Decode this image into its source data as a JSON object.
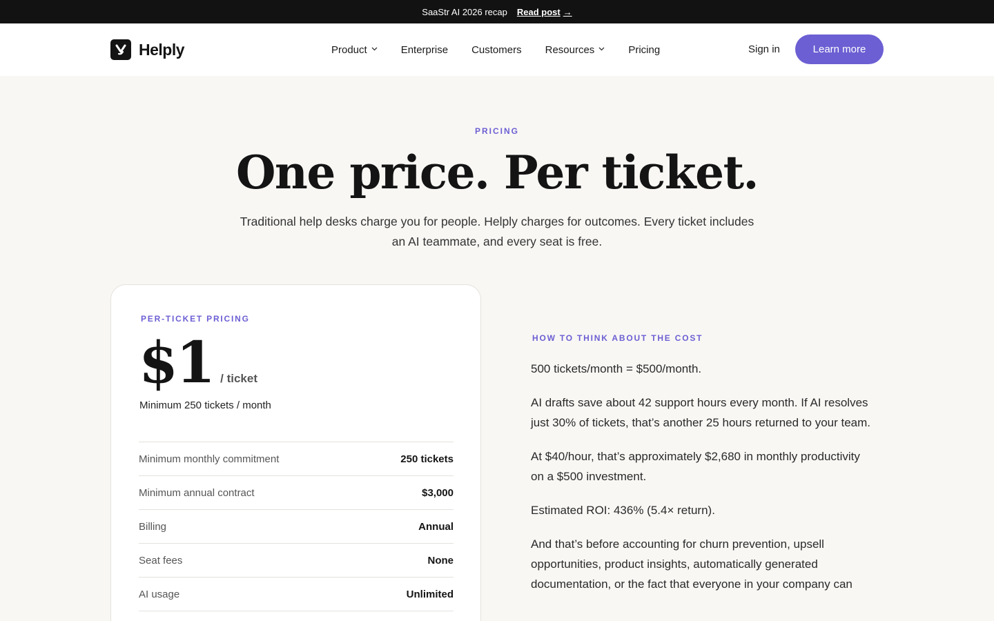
{
  "announcement": {
    "text": "SaaStr AI 2026 recap",
    "link_label": "Read post",
    "link_arrow": "→"
  },
  "header": {
    "brand": "Helply",
    "nav": [
      {
        "label": "Product",
        "dropdown": true
      },
      {
        "label": "Enterprise",
        "dropdown": false
      },
      {
        "label": "Customers",
        "dropdown": false
      },
      {
        "label": "Resources",
        "dropdown": true
      },
      {
        "label": "Pricing",
        "dropdown": false
      }
    ],
    "sign_in": "Sign in",
    "cta": "Learn more"
  },
  "hero": {
    "eyebrow": "PRICING",
    "title": "One price. Per ticket.",
    "subtitle": "Traditional help desks charge you for people. Helply charges for outcomes. Every ticket includes an AI teammate, and every seat is free."
  },
  "card": {
    "eyebrow": "PER-TICKET PRICING",
    "price": "$1",
    "unit": "/ ticket",
    "minimum": "Minimum 250 tickets / month",
    "rows": [
      {
        "label": "Minimum monthly commitment",
        "value": "250 tickets"
      },
      {
        "label": "Minimum annual contract",
        "value": "$3,000"
      },
      {
        "label": "Billing",
        "value": "Annual"
      },
      {
        "label": "Seat fees",
        "value": "None"
      },
      {
        "label": "AI usage",
        "value": "Unlimited"
      }
    ]
  },
  "cost": {
    "eyebrow": "HOW TO THINK ABOUT THE COST",
    "paragraphs": [
      "500 tickets/month = $500/month.",
      "AI drafts save about 42 support hours every month. If AI resolves just 30% of tickets, that’s another 25 hours returned to your team.",
      "At $40/hour, that’s approximately $2,680 in monthly productivity on a $500 investment.",
      "Estimated ROI: 436% (5.4× return).",
      "And that’s before accounting for churn prevention, upsell opportunities, product insights, automatically generated documentation, or the fact that everyone in your company can"
    ]
  },
  "colors": {
    "accent": "#6c5fd3",
    "announcement_bg": "#121212",
    "page_bg": "#f8f7f4"
  }
}
